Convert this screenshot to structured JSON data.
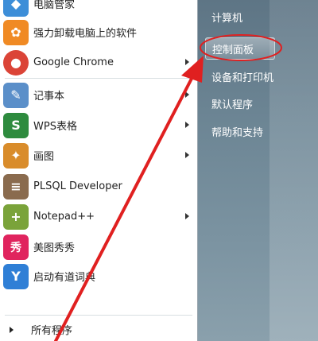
{
  "left_items": [
    {
      "label": "电脑管家",
      "icon": "shield-icon",
      "color": "#3d8ed8",
      "glyph": "◆",
      "submenu": false
    },
    {
      "label": "强力卸载电脑上的软件",
      "icon": "clover-icon",
      "color": "#f08a24",
      "glyph": "✿",
      "submenu": false
    },
    {
      "label": "Google Chrome",
      "icon": "chrome-icon",
      "color": "#db4437",
      "glyph": "●",
      "submenu": true
    },
    {
      "label": "记事本",
      "icon": "notepad-icon",
      "color": "#5b8fc9",
      "glyph": "✎",
      "submenu": true
    },
    {
      "label": "WPS表格",
      "icon": "wps-icon",
      "color": "#2e8b3e",
      "glyph": "S",
      "submenu": true
    },
    {
      "label": "画图",
      "icon": "paint-icon",
      "color": "#d98c2b",
      "glyph": "✦",
      "submenu": true
    },
    {
      "label": "PLSQL Developer",
      "icon": "database-icon",
      "color": "#8a6b4e",
      "glyph": "≡",
      "submenu": false
    },
    {
      "label": "Notepad++",
      "icon": "notepadpp-icon",
      "color": "#7aa33a",
      "glyph": "+",
      "submenu": true
    },
    {
      "label": "美图秀秀",
      "icon": "meitu-icon",
      "color": "#e0245e",
      "glyph": "秀",
      "submenu": false
    },
    {
      "label": "启动有道词典",
      "icon": "youdao-icon",
      "color": "#2f7fd6",
      "glyph": "Y",
      "submenu": false
    }
  ],
  "all_programs": "所有程序",
  "right_items": [
    {
      "label": "计算机"
    },
    {
      "label": "控制面板"
    },
    {
      "label": "设备和打印机"
    },
    {
      "label": "默认程序"
    },
    {
      "label": "帮助和支持"
    }
  ],
  "colors": {
    "annotation": "#e02020"
  }
}
